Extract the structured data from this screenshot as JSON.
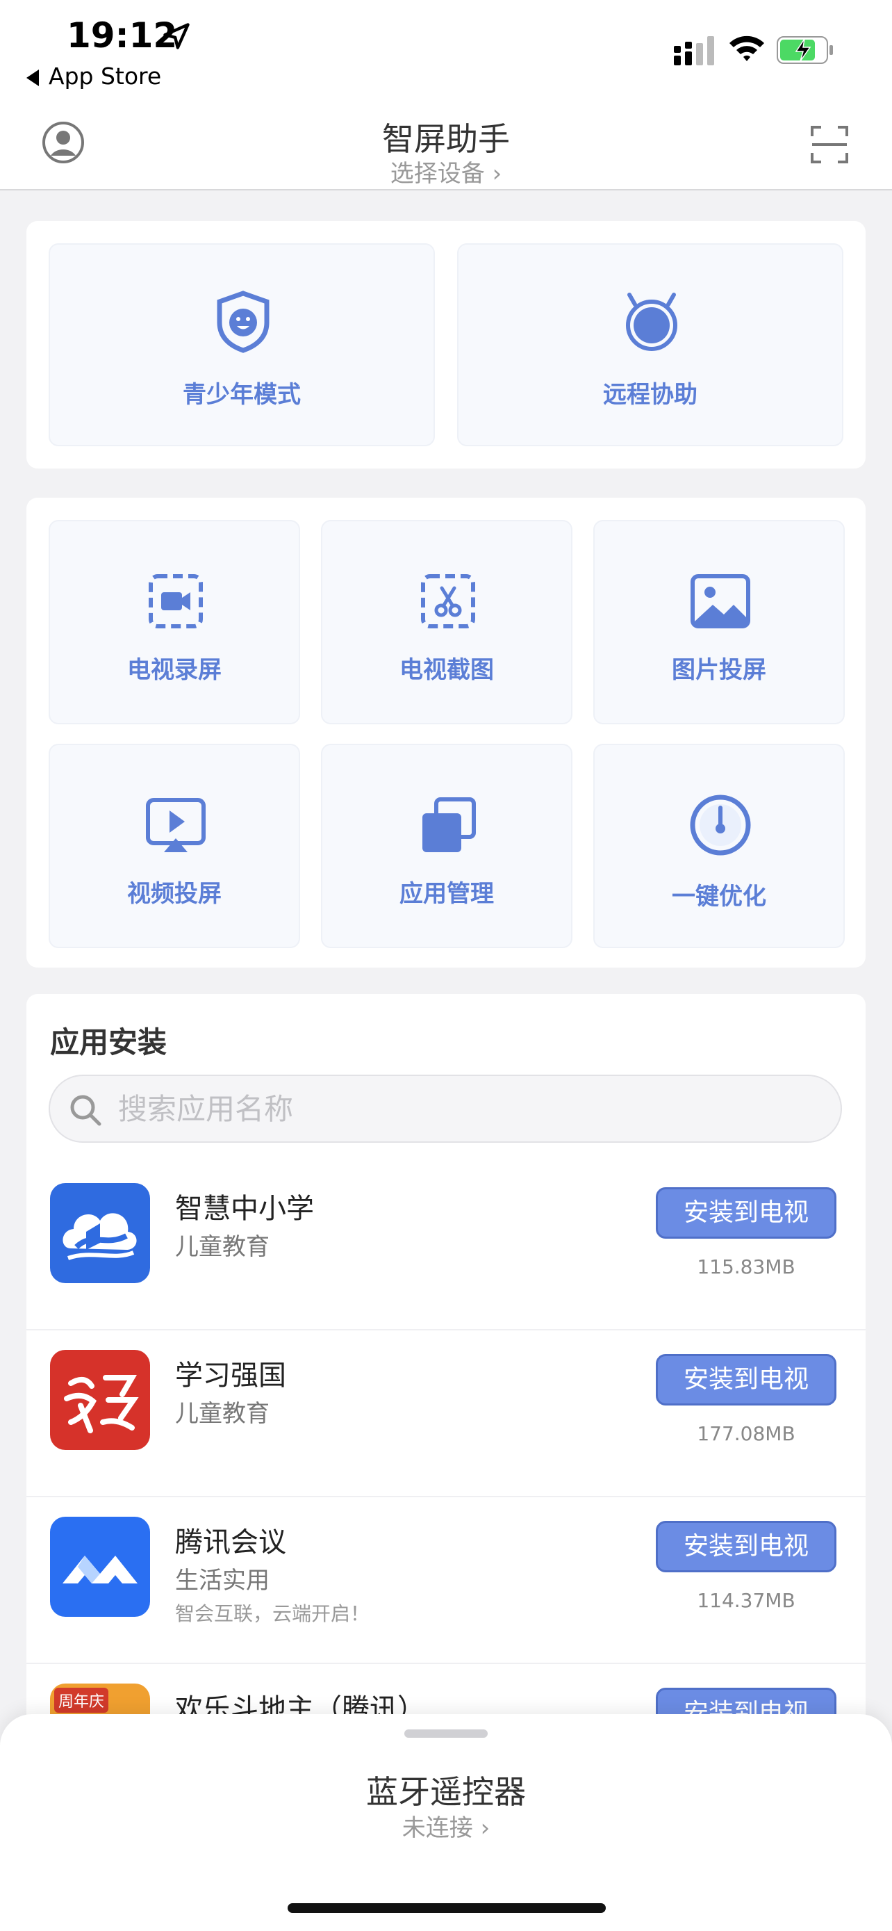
{
  "status_bar": {
    "time": "19:12",
    "back_label": "App Store"
  },
  "nav": {
    "title": "智屏助手",
    "subtitle": "选择设备 ›"
  },
  "quick_actions": [
    {
      "label": "青少年模式",
      "icon": "shield-smile-icon"
    },
    {
      "label": "远程协助",
      "icon": "remote-assist-icon"
    }
  ],
  "tools": [
    {
      "label": "电视录屏",
      "icon": "screen-record-icon"
    },
    {
      "label": "电视截图",
      "icon": "screenshot-icon"
    },
    {
      "label": "图片投屏",
      "icon": "image-cast-icon"
    },
    {
      "label": "视频投屏",
      "icon": "video-cast-icon"
    },
    {
      "label": "应用管理",
      "icon": "app-manage-icon"
    },
    {
      "label": "一键优化",
      "icon": "optimize-icon"
    }
  ],
  "app_install": {
    "title": "应用安装",
    "search_placeholder": "搜索应用名称",
    "install_label": "安装到电视",
    "apps": [
      {
        "name": "智慧中小学",
        "category": "儿童教育",
        "desc": "",
        "size": "115.83MB",
        "icon_color": "#2f6be0"
      },
      {
        "name": "学习强国",
        "category": "儿童教育",
        "desc": "",
        "size": "177.08MB",
        "icon_color": "#d6322a"
      },
      {
        "name": "腾讯会议",
        "category": "生活实用",
        "desc": "智会互联，云端开启！",
        "size": "114.37MB",
        "icon_color": "#2a6ff2"
      },
      {
        "name": "欢乐斗地主（腾讯）",
        "category": "",
        "desc": "",
        "size": "",
        "icon_color": "#f0a030",
        "badge": "周年庆"
      }
    ]
  },
  "bluetooth": {
    "title": "蓝牙遥控器",
    "status": "未连接 ›"
  },
  "colors": {
    "accent": "#6b8ce4",
    "icon_blue": "#5b7ed6"
  }
}
